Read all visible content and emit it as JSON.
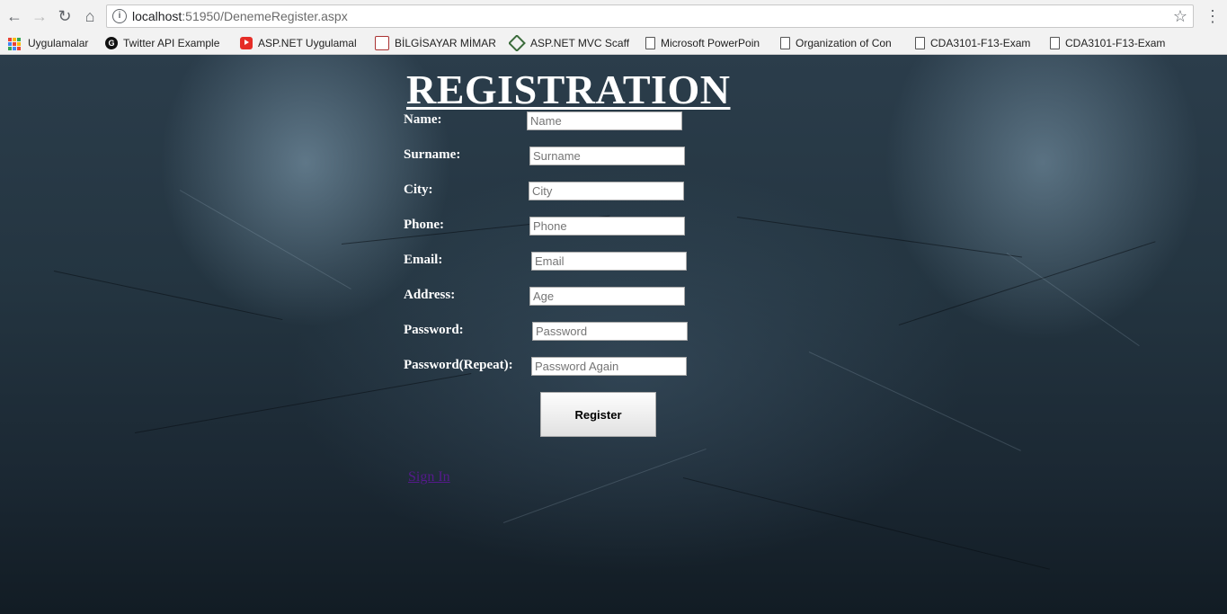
{
  "browser": {
    "url_host": "localhost",
    "url_port_path": ":51950/DenemeRegister.aspx",
    "bookmarks": [
      {
        "label": "Uygulamalar",
        "icon": "apps-grid-icon"
      },
      {
        "label": "Twitter API Example",
        "icon": "g-logo-icon"
      },
      {
        "label": "ASP.NET Uygulamal",
        "icon": "youtube-icon"
      },
      {
        "label": "BİLGİSAYAR MİMARİ",
        "icon": "presentation-icon"
      },
      {
        "label": "ASP.NET MVC Scaffo",
        "icon": "diamond-icon"
      },
      {
        "label": "Microsoft PowerPoin",
        "icon": "document-icon"
      },
      {
        "label": "Organization of Con",
        "icon": "document-icon"
      },
      {
        "label": "CDA3101-F13-Exam",
        "icon": "document-icon"
      },
      {
        "label": "CDA3101-F13-Exam",
        "icon": "document-icon"
      }
    ]
  },
  "form": {
    "title": "REGISTRATION",
    "fields": [
      {
        "label": "Name:",
        "placeholder": "Name"
      },
      {
        "label": "Surname:",
        "placeholder": "Surname"
      },
      {
        "label": "City:",
        "placeholder": "City"
      },
      {
        "label": "Phone:",
        "placeholder": "Phone"
      },
      {
        "label": "Email:",
        "placeholder": "Email"
      },
      {
        "label": "Address:",
        "placeholder": "Age"
      },
      {
        "label": "Password:",
        "placeholder": "Password"
      },
      {
        "label": "Password(Repeat):",
        "placeholder": "Password Again"
      }
    ],
    "register_label": "Register",
    "link_label": "Sign In"
  }
}
